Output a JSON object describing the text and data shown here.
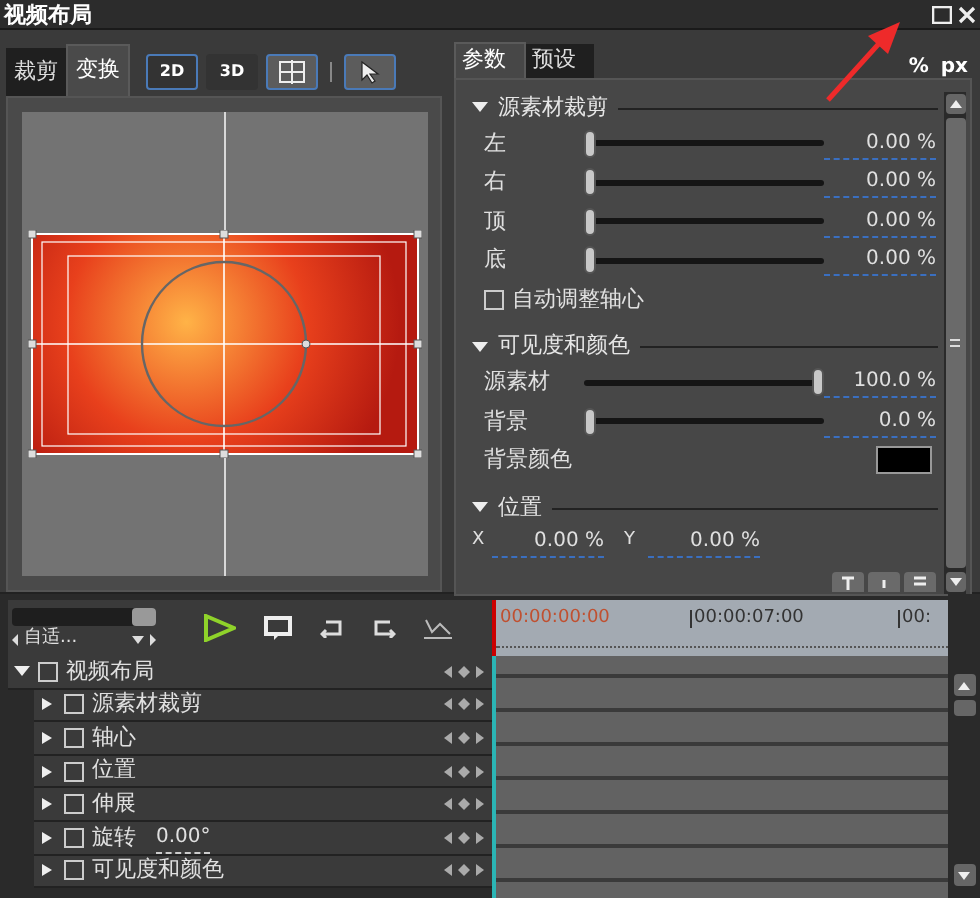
{
  "window": {
    "title": "视频布局"
  },
  "left_tabs": [
    {
      "label": "裁剪",
      "selected": false
    },
    {
      "label": "变换",
      "selected": true
    }
  ],
  "tool_buttons": [
    {
      "kind": "twod",
      "label": "2D",
      "selected": true
    },
    {
      "kind": "threed",
      "label": "3D",
      "selected": false
    },
    {
      "kind": "grid",
      "selected": true
    },
    {
      "kind": "pointer",
      "selected": true
    }
  ],
  "right_tabs": [
    {
      "label": "参数",
      "selected": true
    },
    {
      "label": "预设",
      "selected": false
    }
  ],
  "units": [
    "%",
    "px"
  ],
  "sections": [
    {
      "title": "源素材裁剪",
      "expanded": true,
      "rows": [
        {
          "kind": "slider",
          "label": "左",
          "level": 0,
          "value": "0.00 %"
        },
        {
          "kind": "slider",
          "label": "右",
          "level": 0,
          "value": "0.00 %"
        },
        {
          "kind": "slider",
          "label": "顶",
          "level": 0,
          "value": "0.00 %"
        },
        {
          "kind": "slider",
          "label": "底",
          "level": 0,
          "value": "0.00 %"
        },
        {
          "kind": "checkbox",
          "label": "自动调整轴心",
          "checked": false
        }
      ]
    },
    {
      "title": "可见度和颜色",
      "expanded": true,
      "rows": [
        {
          "kind": "slider",
          "label": "源素材",
          "level": 1,
          "value": "100.0 %"
        },
        {
          "kind": "slider",
          "label": "背景",
          "level": 0,
          "value": "0.0 %"
        },
        {
          "kind": "color",
          "label": "背景颜色",
          "color": "#000000"
        }
      ]
    },
    {
      "title": "位置",
      "expanded": true,
      "rows": [
        {
          "kind": "xy",
          "x_label": "X",
          "x_value": "0.00 %",
          "y_label": "Y",
          "y_value": "0.00 %"
        }
      ]
    }
  ],
  "timeline": {
    "zoom": {
      "level": 1,
      "label": "自适..."
    },
    "ruler": [
      "00:00:00:00",
      "00:00:07:00",
      "00:"
    ]
  },
  "tracks": [
    {
      "label": "视频布局",
      "expanded": true,
      "checked": false,
      "children": [
        {
          "label": "源素材裁剪",
          "expanded": false,
          "checked": false
        },
        {
          "label": "轴心",
          "expanded": false,
          "checked": false
        },
        {
          "label": "位置",
          "expanded": false,
          "checked": false
        },
        {
          "label": "伸展",
          "expanded": false,
          "checked": false
        },
        {
          "label": "旋转",
          "value": "0.00°",
          "expanded": false,
          "checked": false
        },
        {
          "label": "可见度和颜色",
          "expanded": false,
          "checked": false
        }
      ]
    }
  ]
}
